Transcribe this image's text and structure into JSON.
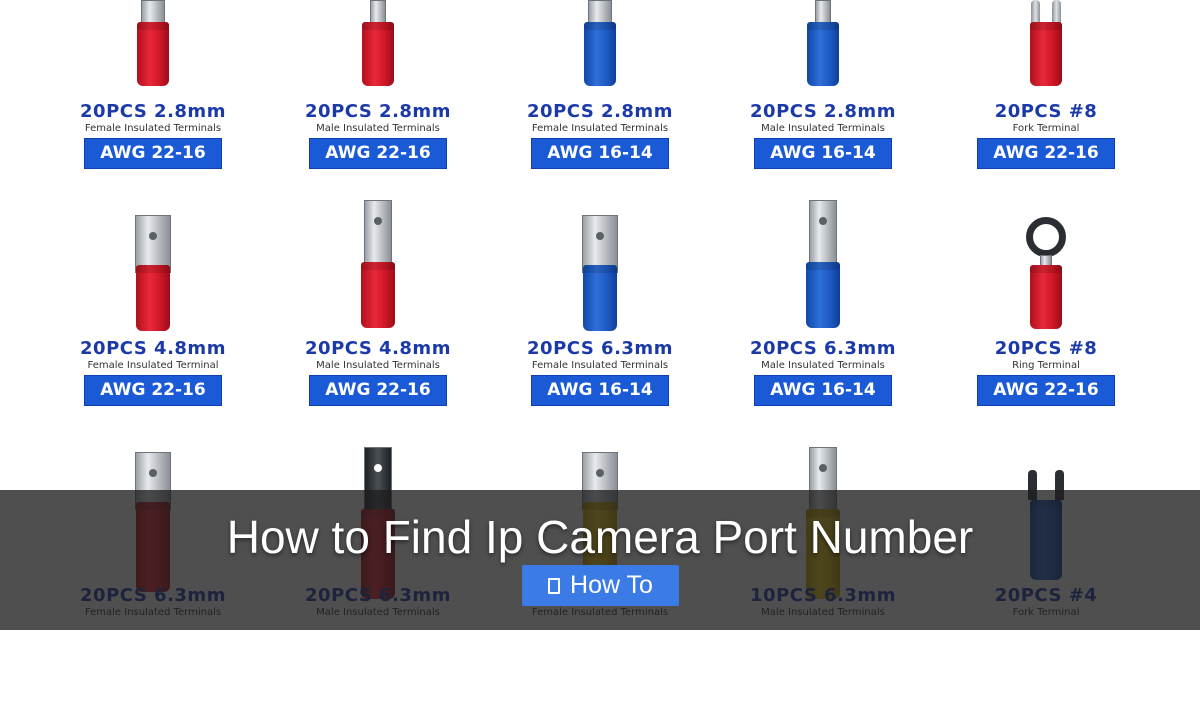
{
  "products": [
    {
      "qty": "20PCS  2.8mm",
      "desc": "Female Insulated Terminals",
      "awg": "AWG 22-16",
      "color": "red",
      "kind": "top-female"
    },
    {
      "qty": "20PCS  2.8mm",
      "desc": "Male Insulated Terminals",
      "awg": "AWG 22-16",
      "color": "red",
      "kind": "top-male"
    },
    {
      "qty": "20PCS  2.8mm",
      "desc": "Female Insulated Terminals",
      "awg": "AWG 16-14",
      "color": "blue",
      "kind": "top-female"
    },
    {
      "qty": "20PCS  2.8mm",
      "desc": "Male Insulated Terminals",
      "awg": "AWG 16-14",
      "color": "blue",
      "kind": "top-male"
    },
    {
      "qty": "20PCS  #8",
      "desc": "Fork Terminal",
      "awg": "AWG 22-16",
      "color": "red",
      "kind": "top-fork"
    },
    {
      "qty": "20PCS  4.8mm",
      "desc": "Female Insulated Terminal",
      "awg": "AWG 22-16",
      "color": "red",
      "kind": "female"
    },
    {
      "qty": "20PCS  4.8mm",
      "desc": "Male Insulated Terminals",
      "awg": "AWG 22-16",
      "color": "red",
      "kind": "male"
    },
    {
      "qty": "20PCS  6.3mm",
      "desc": "Female Insulated Terminals",
      "awg": "AWG 16-14",
      "color": "blue",
      "kind": "female"
    },
    {
      "qty": "20PCS  6.3mm",
      "desc": "Male Insulated Terminals",
      "awg": "AWG 16-14",
      "color": "blue",
      "kind": "male"
    },
    {
      "qty": "20PCS  #8",
      "desc": "Ring Terminal",
      "awg": "AWG 22-16",
      "color": "red",
      "kind": "ring"
    },
    {
      "qty": "20PCS  6.3mm",
      "desc": "Female Insulated Terminals",
      "color": "red",
      "kind": "female"
    },
    {
      "qty": "20PCS  6.3mm",
      "desc": "Male Insulated Terminals",
      "color": "red",
      "kind": "male-dark"
    },
    {
      "qty": "20PCS  6.3mm",
      "desc": "Female Insulated Terminals",
      "color": "yellow",
      "kind": "female"
    },
    {
      "qty": "10PCS  6.3mm",
      "desc": "Male Insulated Terminals",
      "color": "yellow",
      "kind": "male"
    },
    {
      "qty": "20PCS  #4",
      "desc": "Fork Terminal",
      "color": "blue",
      "kind": "fork-dark"
    }
  ],
  "overlay": {
    "title": "How to Find Ip Camera Port Number",
    "category_label": "How To",
    "category_icon": "folder-icon"
  }
}
